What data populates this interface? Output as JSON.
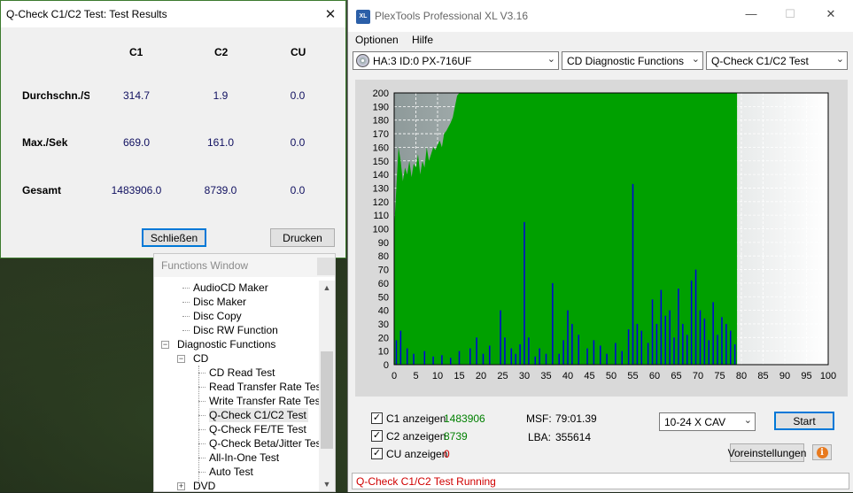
{
  "results_window": {
    "title": "Q-Check C1/C2 Test: Test Results",
    "columns": [
      "C1",
      "C2",
      "CU"
    ],
    "rows": [
      {
        "label": "Durchschn./Sek",
        "values": [
          "314.7",
          "1.9",
          "0.0"
        ]
      },
      {
        "label": "Max./Sek",
        "values": [
          "669.0",
          "161.0",
          "0.0"
        ]
      },
      {
        "label": "Gesamt",
        "values": [
          "1483906.0",
          "8739.0",
          "0.0"
        ]
      }
    ],
    "close_button": "Schließen",
    "print_button": "Drucken"
  },
  "functions_window": {
    "title": "Functions Window",
    "items": [
      {
        "label": "AudioCD Maker",
        "level": 1
      },
      {
        "label": "Disc Maker",
        "level": 1
      },
      {
        "label": "Disc Copy",
        "level": 1
      },
      {
        "label": "Disc RW Function",
        "level": 1
      },
      {
        "label": "Diagnostic Functions",
        "level": 0,
        "expander": "−"
      },
      {
        "label": "CD",
        "level": 1,
        "expander": "−"
      },
      {
        "label": "CD Read Test",
        "level": 2
      },
      {
        "label": "Read Transfer Rate Test",
        "level": 2
      },
      {
        "label": "Write Transfer Rate Test",
        "level": 2
      },
      {
        "label": "Q-Check C1/C2 Test",
        "level": 2,
        "selected": true
      },
      {
        "label": "Q-Check FE/TE Test",
        "level": 2
      },
      {
        "label": "Q-Check Beta/Jitter Test",
        "level": 2
      },
      {
        "label": "All-In-One Test",
        "level": 2
      },
      {
        "label": "Auto Test",
        "level": 2
      },
      {
        "label": "DVD",
        "level": 1,
        "expander": "+"
      }
    ]
  },
  "main_window": {
    "title": "PlexTools Professional XL V3.16",
    "app_icon_text": "XL",
    "menu": [
      "Optionen",
      "Hilfe"
    ],
    "drive_select": "HA:3 ID:0  PX-716UF",
    "function_select": "CD Diagnostic Functions",
    "test_select": "Q-Check C1/C2 Test",
    "c1_label": "C1 anzeigen",
    "c1_value": "1483906",
    "c2_label": "C2 anzeigen",
    "c2_value": "8739",
    "cu_label": "CU anzeigen",
    "cu_value": "0",
    "msf_label": "MSF:",
    "msf_value": "79:01.39",
    "lba_label": "LBA:",
    "lba_value": "355614",
    "speed_select": "10-24 X CAV",
    "start_button": "Start",
    "settings_button": "Voreinstellungen",
    "status": "Q-Check C1/C2 Test Running",
    "colors": {
      "c1_area": "#00a000",
      "c2_bars": "#0000dd",
      "status_text": "#d00000",
      "counter_green": "#008000",
      "counter_red": "#d00000"
    }
  },
  "chart_data": {
    "type": "area",
    "x_ticks": [
      0,
      5,
      10,
      15,
      20,
      25,
      30,
      35,
      40,
      45,
      50,
      55,
      60,
      65,
      70,
      75,
      80,
      85,
      90,
      95,
      100
    ],
    "y_ticks": [
      0,
      10,
      20,
      30,
      40,
      50,
      60,
      70,
      80,
      90,
      100,
      110,
      120,
      130,
      140,
      150,
      160,
      170,
      180,
      190,
      200
    ],
    "xlim": [
      0,
      100
    ],
    "ylim": [
      0,
      200
    ],
    "grid": true,
    "series": [
      {
        "name": "C1",
        "type": "area",
        "x": [
          0,
          0.5,
          1,
          1.5,
          2,
          2.5,
          3,
          3.5,
          4,
          4.5,
          5,
          5.5,
          6,
          6.5,
          7,
          7.5,
          8,
          8.5,
          9,
          9.5,
          10,
          10.5,
          11,
          11.5,
          12,
          12.5,
          13,
          13.5,
          14,
          14.5,
          15,
          79
        ],
        "values": [
          100,
          130,
          160,
          150,
          135,
          145,
          140,
          150,
          138,
          148,
          145,
          155,
          140,
          150,
          145,
          160,
          150,
          155,
          160,
          158,
          162,
          165,
          160,
          170,
          172,
          175,
          178,
          182,
          190,
          198,
          200,
          200
        ]
      },
      {
        "name": "C2",
        "type": "bar",
        "x": [
          0.5,
          1.5,
          3,
          4.5,
          7,
          9,
          11,
          13,
          15,
          17.5,
          19,
          20.5,
          22,
          24.5,
          25.5,
          27,
          28,
          29,
          30,
          31,
          32.5,
          33.5,
          35,
          36.5,
          38,
          39,
          40,
          41,
          42.5,
          44.5,
          46,
          47.5,
          49,
          51,
          52.5,
          54,
          55,
          56,
          57,
          58.5,
          59.5,
          60.5,
          61.5,
          62.5,
          63.5,
          64.5,
          65.5,
          66.5,
          67.5,
          68.5,
          69.5,
          70.5,
          71.5,
          72.5,
          73.5,
          74.5,
          75.5,
          76.5,
          77.5,
          78.5
        ],
        "values": [
          18,
          25,
          12,
          8,
          10,
          6,
          7,
          5,
          10,
          12,
          20,
          8,
          14,
          40,
          20,
          12,
          8,
          15,
          105,
          20,
          6,
          12,
          8,
          60,
          8,
          18,
          40,
          30,
          22,
          12,
          18,
          14,
          8,
          16,
          10,
          26,
          133,
          30,
          25,
          16,
          48,
          30,
          55,
          36,
          40,
          20,
          56,
          30,
          22,
          62,
          70,
          40,
          34,
          18,
          46,
          22,
          35,
          30,
          25,
          15
        ]
      }
    ]
  }
}
